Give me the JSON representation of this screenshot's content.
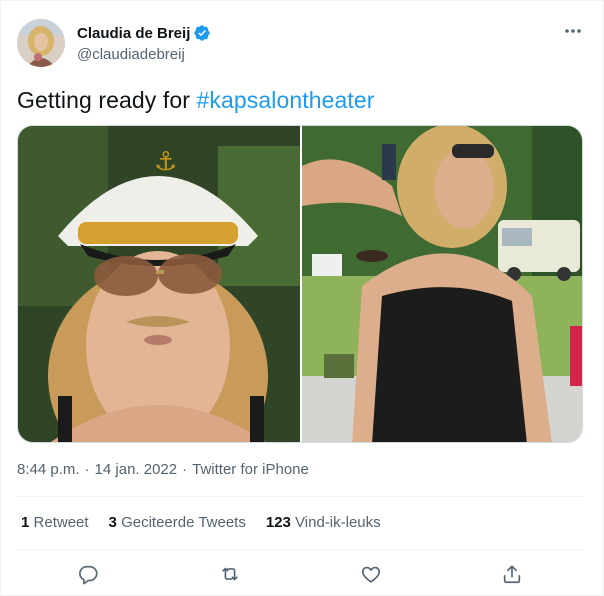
{
  "author": {
    "display_name": "Claudia de Breij",
    "handle": "@claudiadebreij",
    "verified": true
  },
  "tweet": {
    "text_prefix": "Getting ready for ",
    "hashtag": "#kapsalontheater"
  },
  "meta": {
    "time": "8:44 p.m.",
    "date": "14 jan. 2022",
    "source": "Twitter for iPhone"
  },
  "stats": {
    "retweets_count": "1",
    "retweets_label": "Retweet",
    "quotes_count": "3",
    "quotes_label": "Geciteerde Tweets",
    "likes_count": "123",
    "likes_label": "Vind-ik-leuks"
  },
  "icons": {
    "more": "more-horizontal-icon",
    "reply": "reply-icon",
    "retweet": "retweet-icon",
    "like": "heart-icon",
    "share": "share-icon",
    "verified": "verified-badge-icon"
  },
  "colors": {
    "accent": "#1d9bf0",
    "text": "#0f1419",
    "secondary": "#536471",
    "border": "#eff3f4"
  }
}
